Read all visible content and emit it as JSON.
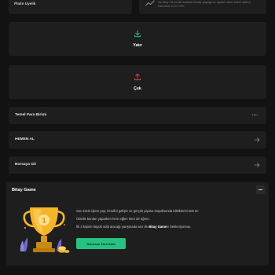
{
  "top": {
    "left_label": "Platin Üyelik",
    "right_note": "Sn Mey 19:04:38 saatine kadar yapılgınız toplam alım satım işlemi hacminiz 0,00 TRY."
  },
  "actions": {
    "deposit_label": "Yatır",
    "withdraw_label": "Çek"
  },
  "rows": {
    "currency_label": "Temel Para Birimi",
    "currency_value": "TRY",
    "buy_label": "HEMEN AL",
    "exchange_label": "Borsaya Git"
  },
  "game": {
    "title": "Bitay Game",
    "line1": "Sen inicle işlem yap, kendini geliştir ve gerçek piyasa koşullarında bildiklerini test et!",
    "line2": "Üstelik bunları yaparken hem eğlen hem de öğren.",
    "line3_pre": "İlk 3 kişinin büyük ödül alacağı yarışmada sen de ",
    "line3_bold": "Bitay Game",
    "line3_post": "'e bekleniyorsun.",
    "cta_label": "Sanırsan Yara Kald",
    "trophy_number": "1"
  },
  "colors": {
    "accent_green": "#26c281",
    "withdraw_red": "#e54848",
    "trophy_gold": "#f3b62b"
  }
}
